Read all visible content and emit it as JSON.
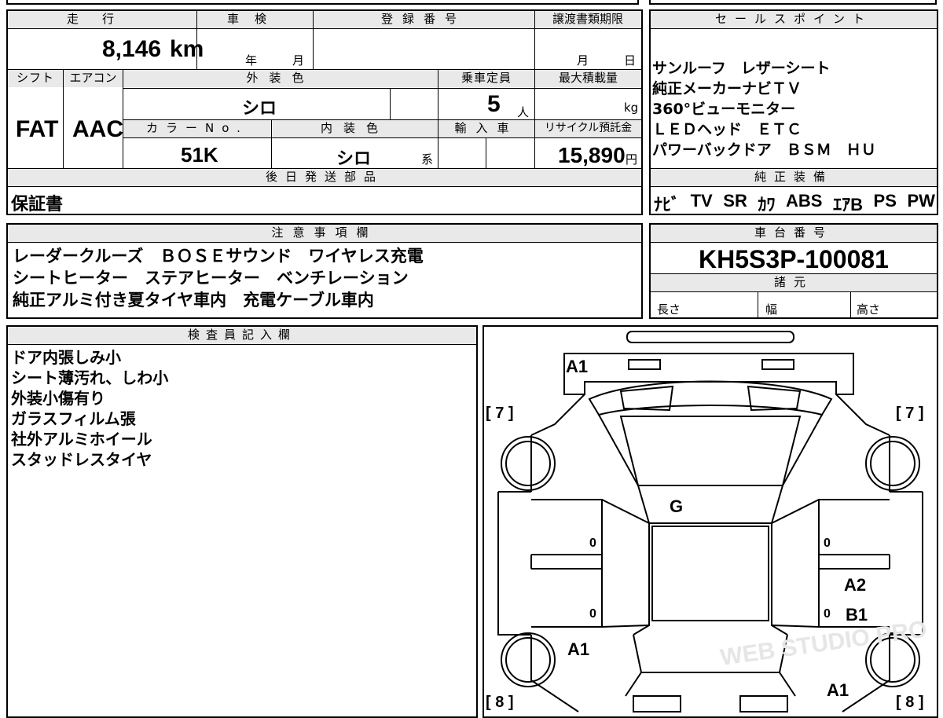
{
  "top_fields": {
    "mileage": {
      "label": "走行",
      "value": "8,146",
      "unit": "km"
    },
    "inspection": {
      "label": "車検",
      "year_label": "年",
      "month_label": "月"
    },
    "registration": {
      "label": "登録番号"
    },
    "transfer_deadline": {
      "label": "譲渡書類期限",
      "month_label": "月",
      "day_label": "日"
    },
    "shift": {
      "label": "シフト",
      "value": "FAT"
    },
    "aircon": {
      "label": "エアコン",
      "value": "AAC"
    },
    "exterior_color": {
      "label": "外装色",
      "value": "シロ"
    },
    "capacity": {
      "label": "乗車定員",
      "value": "5",
      "unit": "人"
    },
    "max_load": {
      "label": "最大積載量",
      "unit": "kg"
    },
    "color_no": {
      "label": "カラーNo.",
      "value": "51K"
    },
    "interior_color": {
      "label": "内装色",
      "value": "シロ",
      "suffix": "系"
    },
    "import": {
      "label": "輸入車"
    },
    "recycle": {
      "label": "リサイクル預託金",
      "value": "15,890",
      "unit": "円"
    },
    "later_parts": {
      "label": "後日発送部品",
      "value": "保証書"
    }
  },
  "sales_points": {
    "label": "セールスポイント",
    "lines": [
      "サンルーフ　レザーシート",
      "純正メーカーナビＴＶ",
      "360°ビューモニター",
      "ＬＥＤヘッド　ＥＴＣ",
      "パワーバックドア　ＢＳＭ　ＨＵ"
    ]
  },
  "genuine_equipment": {
    "label": "純正装備",
    "items": [
      "ﾅﾋﾞ",
      "TV",
      "SR",
      "ｶﾜ",
      "ABS",
      "ｴｱB",
      "PS",
      "PW"
    ]
  },
  "notes": {
    "label": "注意事項欄",
    "lines": [
      "レーダークルーズ　ＢＯＳＥサウンド　ワイヤレス充電",
      "シートヒーター　ステアヒーター　ベンチレーション",
      "純正アルミ付き夏タイヤ車内　充電ケーブル車内"
    ]
  },
  "chassis": {
    "label": "車台番号",
    "value": "KH5S3P-100081"
  },
  "specs": {
    "label": "諸元",
    "length": "長さ",
    "width": "幅",
    "height": "高さ"
  },
  "inspector": {
    "label": "検査員記入欄",
    "lines": [
      "ドア内張しみ小",
      "シート薄汚れ、しわ小",
      "外装小傷有り",
      "ガラスフィルム張",
      "社外アルミホイール",
      "スタッドレスタイヤ"
    ]
  },
  "diagram": {
    "tire_front_left": "[ 7 ]",
    "tire_front_right": "[ 7 ]",
    "tire_rear_left": "[ 8 ]",
    "tire_rear_right": "[ 8 ]",
    "marks": {
      "front_bumper": "A1",
      "windshield": "G",
      "right_front_door": "A2",
      "right_rear_door": "B1",
      "left_rear_fender": "A1",
      "right_rear_fender": "A1",
      "door_l1": "0",
      "door_l2": "0",
      "door_r1": "0",
      "door_r2": "0"
    },
    "watermark": "WEB STUDIO PRO"
  }
}
